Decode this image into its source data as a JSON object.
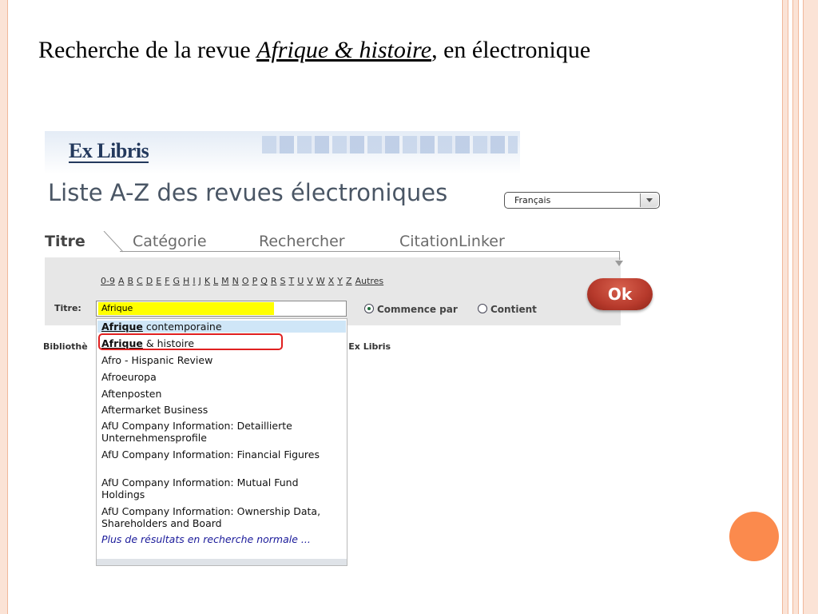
{
  "slide": {
    "title_prefix": "Recherche de la revue ",
    "title_journal": "Afrique & histoire",
    "title_suffix": ", en électronique"
  },
  "banner": {
    "logo_text": "Ex Libris"
  },
  "app": {
    "title": "Liste A-Z des revues électroniques"
  },
  "language_select": {
    "selected": "Français"
  },
  "tabs": [
    {
      "label": "Titre",
      "active": true
    },
    {
      "label": "Catégorie",
      "active": false
    },
    {
      "label": "Rechercher",
      "active": false
    },
    {
      "label": "CitationLinker",
      "active": false
    }
  ],
  "alphabet": [
    "0-9",
    "A",
    "B",
    "C",
    "D",
    "E",
    "F",
    "G",
    "H",
    "I",
    "J",
    "K",
    "L",
    "M",
    "N",
    "O",
    "P",
    "Q",
    "R",
    "S",
    "T",
    "U",
    "V",
    "W",
    "X",
    "Y",
    "Z",
    "Autres"
  ],
  "search": {
    "label": "Titre:",
    "value": "Afrique",
    "options": [
      {
        "label": "Commence par",
        "selected": true
      },
      {
        "label": "Contient",
        "selected": false
      }
    ],
    "submit": "Ok"
  },
  "footer": {
    "left": "Bibliothè",
    "right": "r Ex Libris"
  },
  "dropdown": {
    "items": [
      {
        "match": "Afrique",
        "rest": " contemporaine"
      },
      {
        "match": "Afrique",
        "rest": " & histoire"
      },
      {
        "match": "",
        "rest": "Afro - Hispanic Review"
      },
      {
        "match": "",
        "rest": "Afroeuropa"
      },
      {
        "match": "",
        "rest": "Aftenposten"
      },
      {
        "match": "",
        "rest": "Aftermarket Business"
      },
      {
        "match": "",
        "rest": "AfU Company Information: Detaillierte Unternehmensprofile"
      },
      {
        "match": "",
        "rest": "AfU Company Information: Financial Figures"
      },
      {
        "match": "",
        "rest": "AfU Company Information: Mutual Fund Holdings"
      },
      {
        "match": "",
        "rest": "AfU Company Information: Ownership Data, Shareholders and Board"
      }
    ],
    "more": "Plus de résultats en recherche normale ..."
  },
  "colors": {
    "accent_orange": "#fb8a4d",
    "ok_button": "#b73a2c",
    "highlight_yellow": "#ffff00",
    "annotation_red": "#e02020"
  }
}
